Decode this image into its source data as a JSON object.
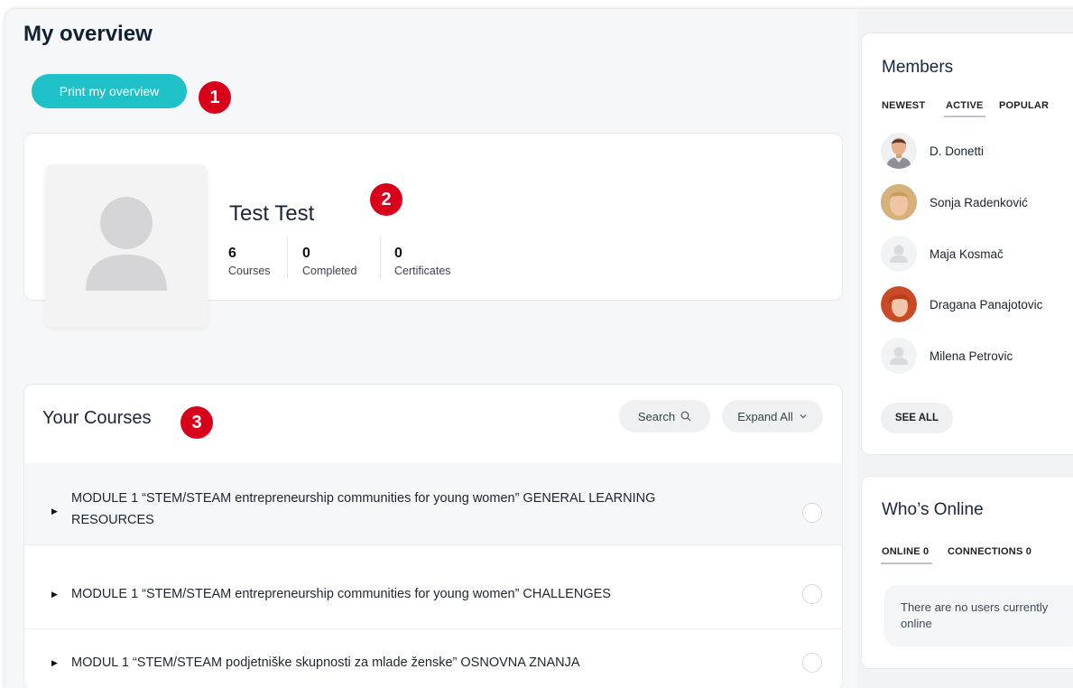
{
  "page": {
    "title": "My overview",
    "print_label": "Print my overview"
  },
  "badges": [
    "1",
    "2",
    "3"
  ],
  "profile": {
    "name": "Test Test",
    "stats": [
      {
        "value": "6",
        "label": "Courses"
      },
      {
        "value": "0",
        "label": "Completed"
      },
      {
        "value": "0",
        "label": "Certificates"
      }
    ]
  },
  "courses": {
    "title": "Your Courses",
    "search_label": "Search",
    "expand_label": "Expand All",
    "items": [
      {
        "title_line1": "MODULE 1 “STEM/STEAM entrepreneurship communities for young women” GENERAL LEARNING",
        "title_line2": "RESOURCES"
      },
      {
        "title_line1": "MODULE 1 “STEM/STEAM entrepreneurship communities for young women” CHALLENGES",
        "title_line2": ""
      },
      {
        "title_line1": "MODUL 1 “STEM/STEAM podjetniške skupnosti za mlade ženske” OSNOVNA ZNANJA",
        "title_line2": ""
      }
    ]
  },
  "members": {
    "title": "Members",
    "tabs": [
      "NEWEST",
      "ACTIVE",
      "POPULAR"
    ],
    "active_tab": "ACTIVE",
    "list": [
      {
        "name": "D. Donetti",
        "avatar": "male-photo"
      },
      {
        "name": "Sonja Radenković",
        "avatar": "female-blonde-photo"
      },
      {
        "name": "Maja Kosmač",
        "avatar": "placeholder"
      },
      {
        "name": "Dragana Panajotovic",
        "avatar": "female-redhead-photo"
      },
      {
        "name": "Milena Petrovic",
        "avatar": "placeholder"
      }
    ],
    "see_all": "SEE ALL"
  },
  "online": {
    "title": "Who’s Online",
    "tabs": [
      {
        "label": "ONLINE",
        "count": "0"
      },
      {
        "label": "CONNECTIONS",
        "count": "0"
      }
    ],
    "message": "There are no users currently online"
  },
  "colors": {
    "accent": "#1fc1c9",
    "badge": "#d9001b"
  }
}
